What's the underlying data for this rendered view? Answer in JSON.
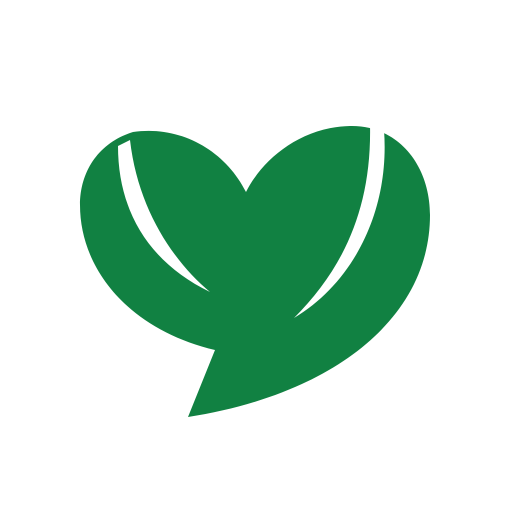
{
  "app_icon": {
    "background_color": "#ffffff",
    "brand_color": "#118142",
    "cutout_color": "#ffffff",
    "icon_name": "heart-speech-bubble-leaf-icon"
  }
}
